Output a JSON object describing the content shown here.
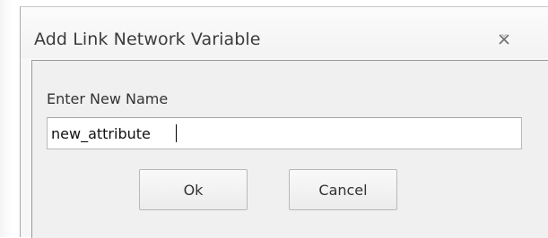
{
  "dialog": {
    "title": "Add Link Network Variable",
    "close_icon": "close-icon",
    "prompt_label": "Enter New Name",
    "name_input_value": "new_attribute",
    "ok_label": "Ok",
    "cancel_label": "Cancel"
  },
  "colors": {
    "dialog_background": "#f7f7f7",
    "client_background": "#f0f0f0",
    "button_border": "#b8b8b8",
    "text": "#333333"
  }
}
